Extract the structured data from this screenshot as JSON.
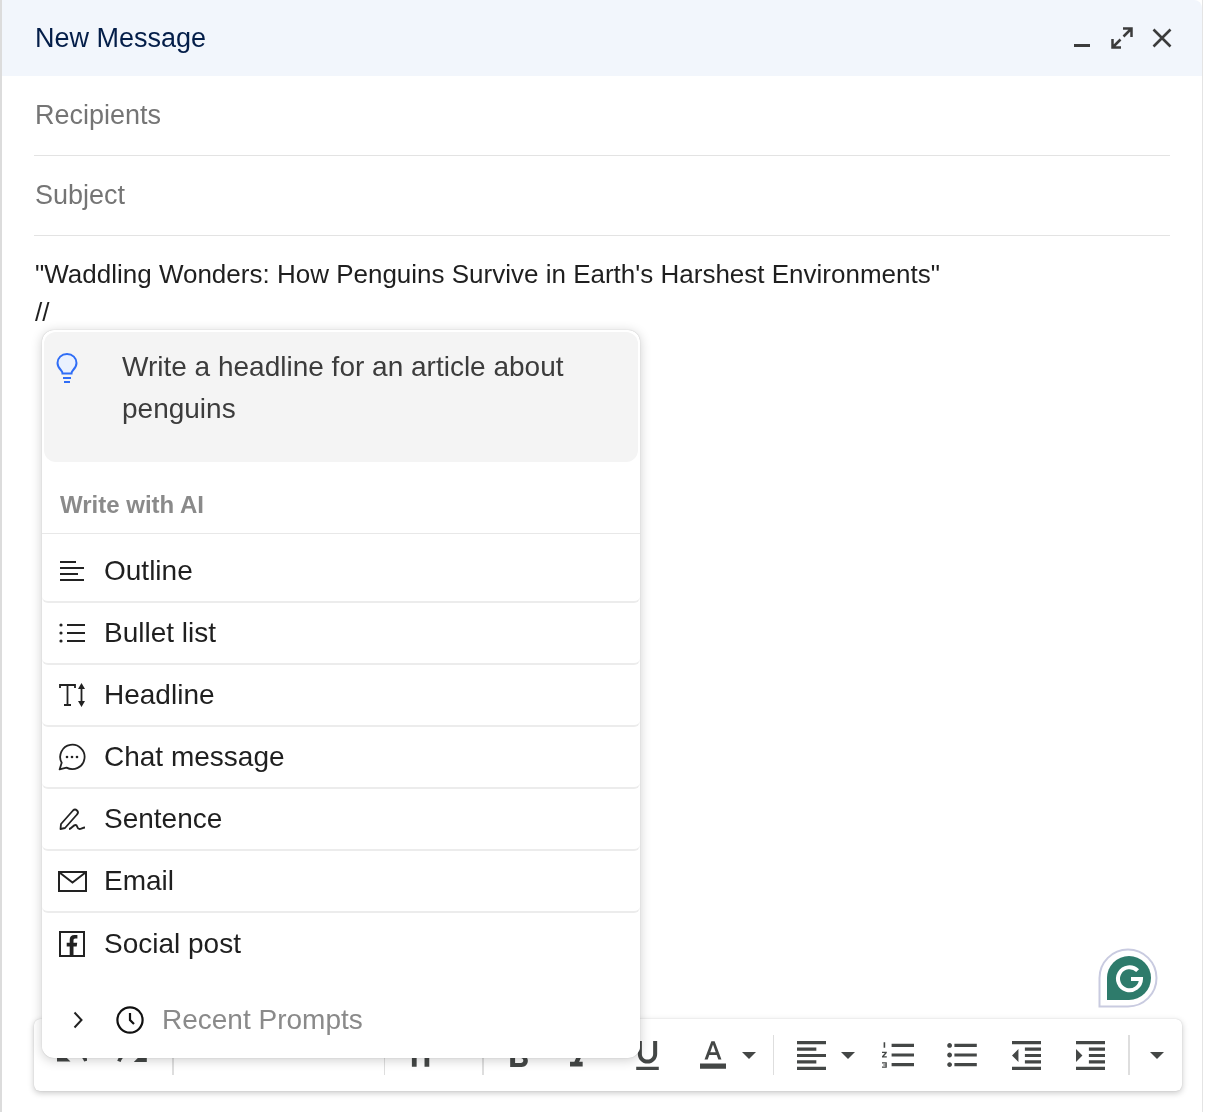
{
  "window": {
    "title": "New Message"
  },
  "recipients": {
    "placeholder": "Recipients"
  },
  "subject": {
    "placeholder": "Subject"
  },
  "body": {
    "lines": [
      "\"Waddling Wonders: How Penguins Survive in Earth's Harshest Environments\"",
      "//"
    ]
  },
  "ai_menu": {
    "suggestion": {
      "text": "Write a headline for an article about penguins"
    },
    "heading": "Write with AI",
    "items": [
      {
        "label": "Outline"
      },
      {
        "label": "Bullet list"
      },
      {
        "label": "Headline"
      },
      {
        "label": "Chat message"
      },
      {
        "label": "Sentence"
      },
      {
        "label": "Email"
      },
      {
        "label": "Social post"
      }
    ],
    "recent_prompts": {
      "label": "Recent Prompts",
      "expanded": false
    }
  }
}
